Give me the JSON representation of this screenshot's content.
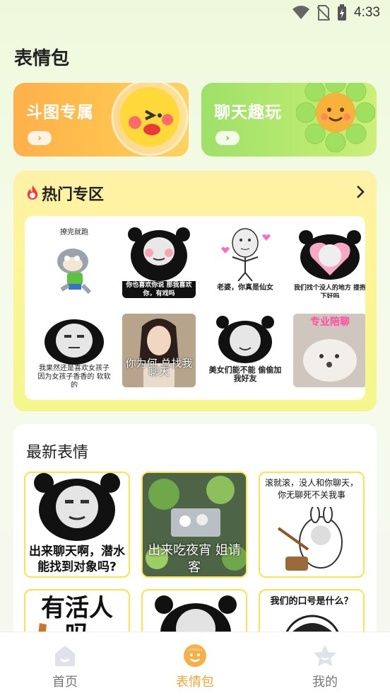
{
  "status_bar": {
    "time": "4:33"
  },
  "page_title": "表情包",
  "promos": [
    {
      "title": "斗图专属",
      "arrow": "›"
    },
    {
      "title": "聊天趣玩",
      "arrow": "›"
    }
  ],
  "hot": {
    "title": "热门专区",
    "stickers": [
      {
        "caption": "撩完就跑"
      },
      {
        "caption": "你也喜欢你说 那我喜欢你，有戏吗"
      },
      {
        "caption": "老婆，你真是仙女"
      },
      {
        "caption": "我们找个没人的地方 搂抱下好吗"
      },
      {
        "caption": "我果然还是喜欢女孩子 因为女孩子香香的 软软的"
      },
      {
        "caption": "你为何 总找我聊天"
      },
      {
        "caption": "美女们能不能 偷偷加我好友"
      },
      {
        "caption": "专业陪聊"
      }
    ]
  },
  "latest": {
    "title": "最新表情",
    "cards": [
      {
        "caption": "出来聊天啊，潜水 能找到对象吗?"
      },
      {
        "caption": "出来吃夜宵 姐请客"
      },
      {
        "caption": "滚就滚，没人和你聊天， 你无聊死不关我事"
      },
      {
        "caption": "有活人 吗"
      },
      {
        "caption": ""
      },
      {
        "caption": "我们的口号是什么？"
      }
    ]
  },
  "tabs": [
    {
      "label": "首页",
      "icon": "home-icon",
      "active": false
    },
    {
      "label": "表情包",
      "icon": "smile-face-icon",
      "active": true
    },
    {
      "label": "我的",
      "icon": "star-icon",
      "active": false
    }
  ],
  "colors": {
    "accent": "#f3a737",
    "hot_bg": "#fff49a",
    "card_border": "#ffe24a"
  }
}
